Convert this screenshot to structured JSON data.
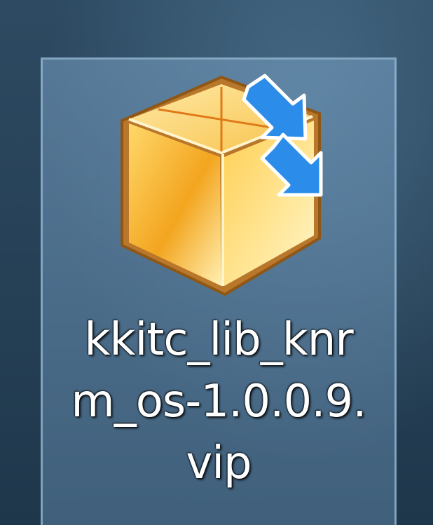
{
  "desktop": {
    "icon": {
      "icon_name": "vip-package-icon",
      "label_line1": "kkitc_lib_knr",
      "label_line2": "m_os-1.0.0.9.",
      "label_line3": "vip",
      "selected": true
    }
  },
  "colors": {
    "selection_border": "#96b9d2",
    "box_body": "#f7b733",
    "box_edge": "#a86a1c",
    "arrow_blue": "#1e88e5"
  }
}
